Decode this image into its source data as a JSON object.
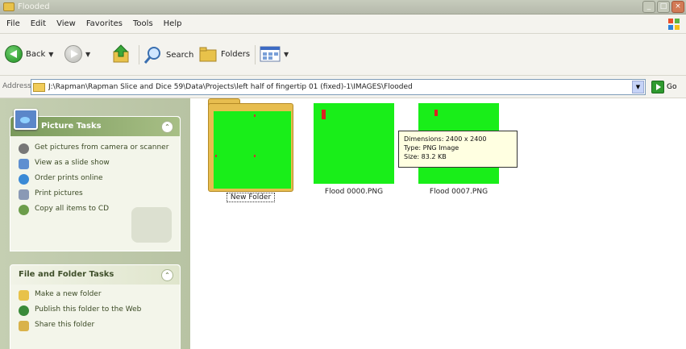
{
  "window": {
    "title": "Flooded"
  },
  "menu": [
    "File",
    "Edit",
    "View",
    "Favorites",
    "Tools",
    "Help"
  ],
  "toolbar": {
    "back_label": "Back",
    "search_label": "Search",
    "folders_label": "Folders"
  },
  "address": {
    "label": "Address",
    "path": "J:\\Rapman\\Rapman Slice and Dice 59\\Data\\Projects\\left half of fingertip 01 (fixed)-1\\IMAGES\\Flooded",
    "go_label": "Go"
  },
  "picture_tasks": {
    "title": "Picture Tasks",
    "items": [
      {
        "label": "Get pictures from camera or scanner",
        "icon": "camera-icon"
      },
      {
        "label": "View as a slide show",
        "icon": "slideshow-icon"
      },
      {
        "label": "Order prints online",
        "icon": "globe-icon"
      },
      {
        "label": "Print pictures",
        "icon": "printer-icon"
      },
      {
        "label": "Copy all items to CD",
        "icon": "cd-icon"
      }
    ]
  },
  "file_tasks": {
    "title": "File and Folder Tasks",
    "items": [
      {
        "label": "Make a new folder",
        "icon": "new-folder-icon"
      },
      {
        "label": "Publish this folder to the Web",
        "icon": "publish-web-icon"
      },
      {
        "label": "Share this folder",
        "icon": "share-folder-icon"
      }
    ]
  },
  "files": [
    {
      "name": "New Folder",
      "type": "folder"
    },
    {
      "name": "Flood 0000.PNG",
      "type": "image"
    },
    {
      "name": "Flood 0007.PNG",
      "type": "image"
    }
  ],
  "tooltip": {
    "dimensions": "Dimensions: 2400 x 2400",
    "type": "Type: PNG Image",
    "size": "Size: 83.2 KB"
  },
  "colors": {
    "thumb_green": "#19ee19",
    "sidebar": "#c5cfb2",
    "folder": "#e7bd4f"
  }
}
